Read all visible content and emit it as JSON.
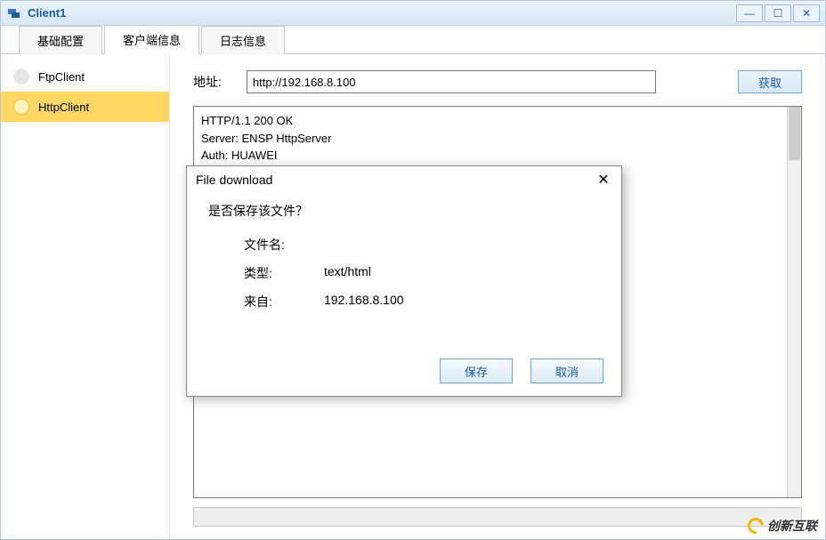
{
  "window": {
    "title": "Client1"
  },
  "tabs": [
    {
      "label": "基础配置"
    },
    {
      "label": "客户端信息"
    },
    {
      "label": "日志信息"
    }
  ],
  "sidebar": {
    "items": [
      {
        "label": "FtpClient"
      },
      {
        "label": "HttpClient"
      }
    ]
  },
  "main": {
    "address_label": "地址:",
    "address_value": "http://192.168.8.100",
    "get_label": "获取",
    "response_lines": [
      "HTTP/1.1 200 OK",
      "Server: ENSP HttpServer",
      "Auth: HUAWEI"
    ]
  },
  "dialog": {
    "title": "File download",
    "question": "是否保存该文件？",
    "filename_label": "文件名:",
    "filename_value": "",
    "type_label": "类型:",
    "type_value": "text/html",
    "from_label": "来自:",
    "from_value": "192.168.8.100",
    "save_label": "保存",
    "cancel_label": "取消"
  },
  "watermark": {
    "text": "创新互联"
  }
}
